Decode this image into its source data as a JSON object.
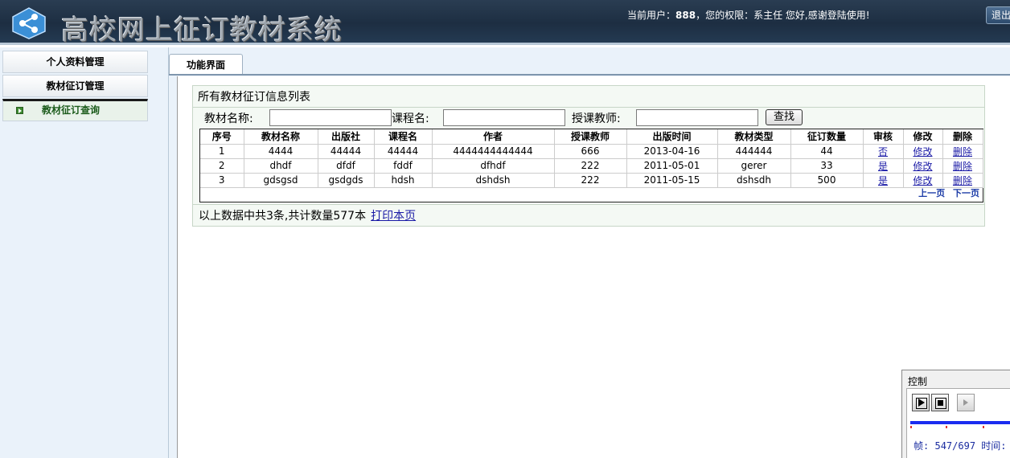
{
  "header": {
    "title": "高校网上征订教材系统",
    "user_prefix": "当前用户：",
    "user_name": "888",
    "user_suffix": "，您的权限：系主任 您好,感谢登陆使用!",
    "logout_label": "退出",
    "logo_icon": "share-node-icon"
  },
  "sidebar": {
    "items": [
      {
        "label": "个人资料管理"
      },
      {
        "label": "教材征订管理"
      },
      {
        "label": "教材征订查询",
        "active": true
      }
    ]
  },
  "main": {
    "tab_label": "功能界面",
    "panel_title": "所有教材征订信息列表",
    "search": {
      "book_label": "教材名称:",
      "course_label": "课程名:",
      "teacher_label": "授课教师:",
      "book_value": "",
      "course_value": "",
      "teacher_value": "",
      "find_label": "查找"
    },
    "table": {
      "columns": [
        "序号",
        "教材名称",
        "出版社",
        "课程名",
        "作者",
        "授课教师",
        "出版时间",
        "教材类型",
        "征订数量",
        "审核",
        "修改",
        "删除"
      ],
      "rows": [
        {
          "no": "1",
          "name": "4444",
          "publisher": "44444",
          "course": "44444",
          "author": "4444444444444",
          "teacher": "666",
          "date": "2013-04-16",
          "type": "444444",
          "qty": "44",
          "audit": "否",
          "edit": "修改",
          "del": "删除"
        },
        {
          "no": "2",
          "name": "dhdf",
          "publisher": "dfdf",
          "course": "fddf",
          "author": "dfhdf",
          "teacher": "222",
          "date": "2011-05-01",
          "type": "gerer",
          "qty": "33",
          "audit": "是",
          "edit": "修改",
          "del": "删除"
        },
        {
          "no": "3",
          "name": "gdsgsd",
          "publisher": "gsdgds",
          "course": "hdsh",
          "author": "dshdsh",
          "teacher": "222",
          "date": "2011-05-15",
          "type": "dshsdh",
          "qty": "500",
          "audit": "是",
          "edit": "修改",
          "del": "删除"
        }
      ],
      "prev_label": "上一页",
      "next_label": "下一页"
    },
    "summary_text": "以上数据中共3条,共计数量577本",
    "print_label": "打印本页"
  },
  "control": {
    "title": "控制",
    "frame_label": "帧:",
    "frame_value": "547/697",
    "time_label": "时间:"
  }
}
